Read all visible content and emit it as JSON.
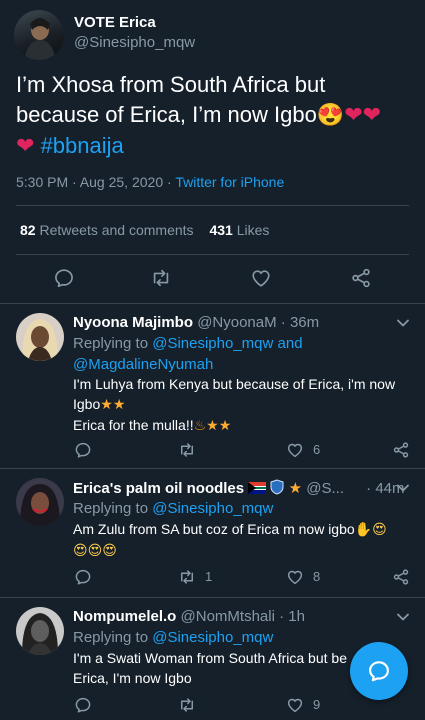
{
  "main_tweet": {
    "display_name": "VOTE Erica",
    "handle": "@Sinesipho_mqw",
    "text_line1": "I’m Xhosa from South Africa but",
    "text_line2": "because of Erica, I’m now Igbo",
    "hashtag": "#bbnaija",
    "timestamp": "5:30 PM · Aug 25, 2020",
    "sep": "·",
    "source": "Twitter for iPhone",
    "retweets_count": "82",
    "retweets_label": "Retweets and comments",
    "likes_count": "431",
    "likes_label": "Likes",
    "actions": [
      "comment-icon",
      "retweet-icon",
      "like-icon",
      "share-icon"
    ]
  },
  "replies": [
    {
      "display_name": "Nyoona Majimbo",
      "handle": "@NyoonaM",
      "time": "· 36m",
      "replying_prefix": "Replying to",
      "replying_to_1": "@Sinesipho_mqw and",
      "replying_to_2": "@MagdalineNyumah",
      "text_line1": "I'm Luhya from Kenya but because of Erica, i'm now",
      "text_line2": "Igbo",
      "text_line3": "Erica for the mulla!!",
      "retweets": "",
      "likes": "6"
    },
    {
      "display_name": "Erica's palm oil noodles",
      "handle": "@S...",
      "time": "· 44m",
      "replying_prefix": "Replying to",
      "replying_to_1": "@Sinesipho_mqw",
      "text_line1": "Am Zulu from SA but coz of Erica m now igbo",
      "retweets": "1",
      "likes": "8"
    },
    {
      "display_name": "Nompumelel.o",
      "handle": "@NomMtshali",
      "time": "· 1h",
      "replying_prefix": "Replying to",
      "replying_to_1": "@Sinesipho_mqw",
      "text_line1": "I'm a Swati Woman from South Africa but be",
      "text_line2": "Erica, I'm now Igbo",
      "retweets": "",
      "likes": "9"
    }
  ],
  "colors": {
    "background": "#15202b",
    "accent": "#1da1f2",
    "muted": "#8899a6",
    "divider": "#38444d",
    "heart": "#e0245e"
  },
  "fab": {
    "icon": "compose-reply-icon"
  }
}
